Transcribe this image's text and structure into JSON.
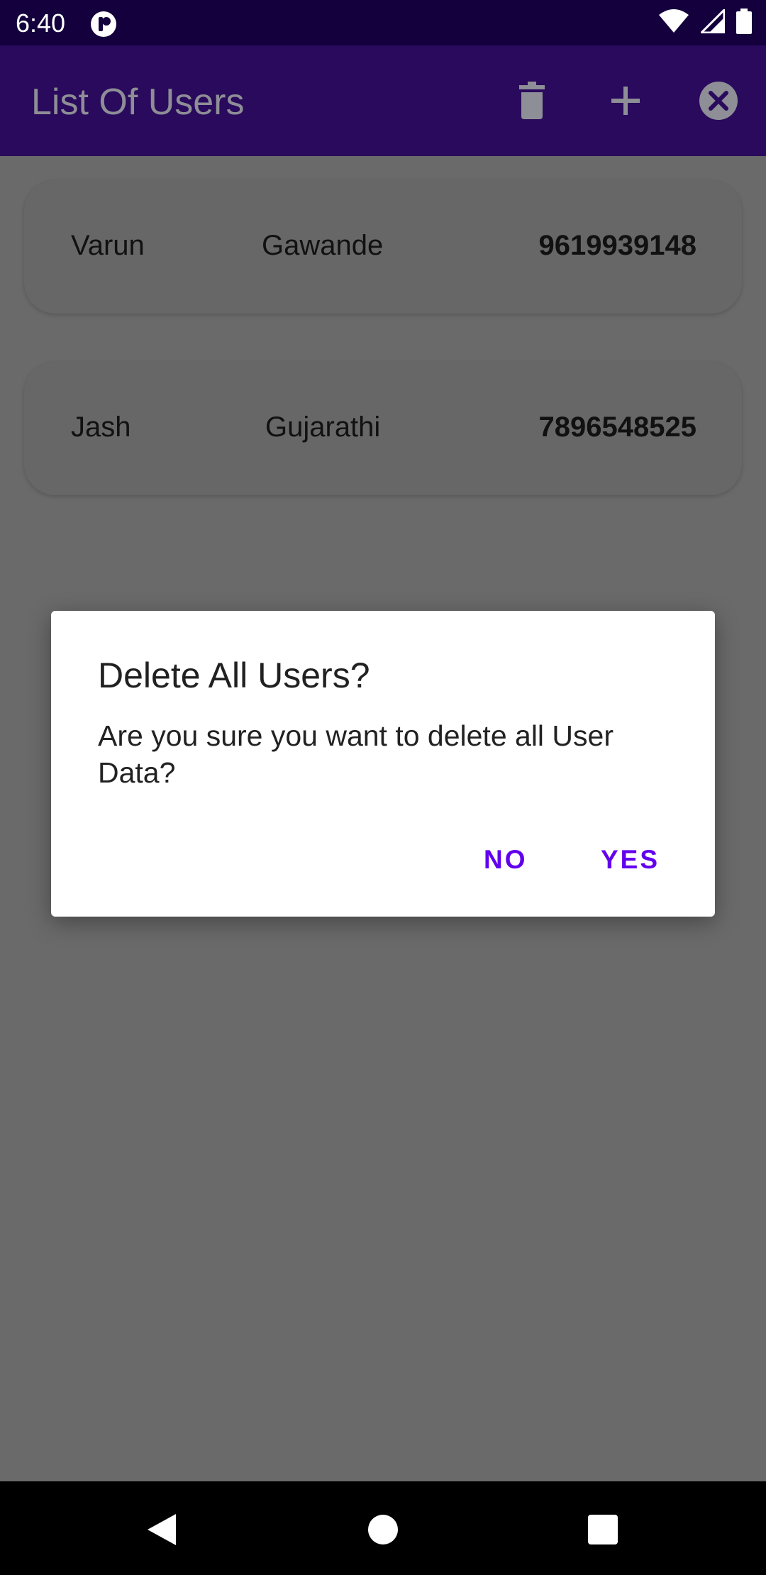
{
  "status_bar": {
    "time": "6:40",
    "icons": [
      "app-notification-icon",
      "wifi-icon",
      "signal-icon",
      "battery-icon"
    ]
  },
  "app_bar": {
    "title": "List Of Users",
    "actions": [
      "delete-icon",
      "add-icon",
      "close-icon"
    ],
    "color": "#2a0a5c"
  },
  "users": [
    {
      "first_name": "Varun",
      "last_name": "Gawande",
      "phone": "9619939148"
    },
    {
      "first_name": "Jash",
      "last_name": "Gujarathi",
      "phone": "7896548525"
    }
  ],
  "dialog": {
    "title": "Delete All Users?",
    "message": "Are you sure you want to delete all User Data?",
    "negative_label": "NO",
    "positive_label": "YES",
    "accent_color": "#6200ee"
  },
  "nav_bar": {
    "icons": [
      "back-icon",
      "home-icon",
      "recents-icon"
    ]
  }
}
